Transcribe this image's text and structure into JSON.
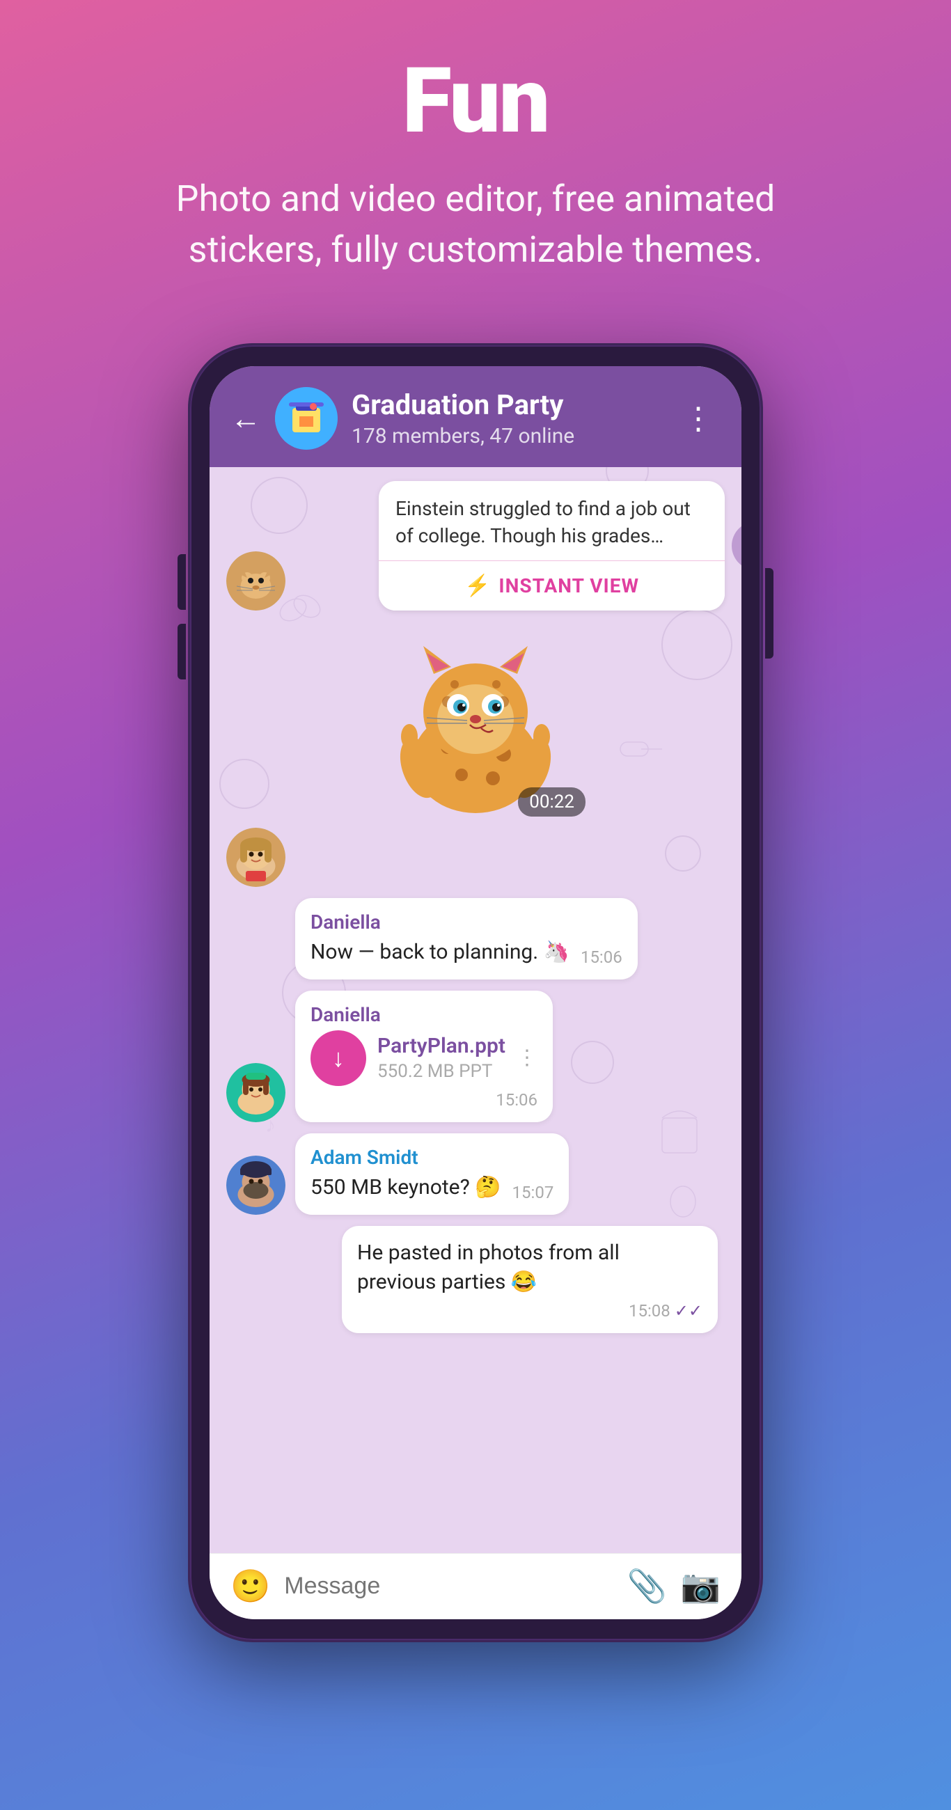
{
  "page": {
    "title": "Fun",
    "subtitle": "Photo and video editor, free animated stickers, fully customizable themes.",
    "header": {
      "group_name": "Graduation Party",
      "group_meta": "178 members, 47 online",
      "back_label": "←",
      "more_label": "⋮"
    },
    "messages": [
      {
        "type": "article",
        "text": "Einstein struggled to find a job out of college. Though his grades…",
        "instant_view_label": "INSTANT VIEW"
      },
      {
        "type": "sticker",
        "timer": "00:22"
      },
      {
        "type": "incoming",
        "sender": "Daniella",
        "text": "Now — back to planning. 🦄",
        "time": "15:06"
      },
      {
        "type": "file",
        "sender": "Daniella",
        "file_name": "PartyPlan.ppt",
        "file_size": "550.2 MB PPT",
        "time": "15:06"
      },
      {
        "type": "incoming2",
        "sender": "Adam Smidt",
        "text": "550 MB keynote? 🤔",
        "time": "15:07"
      },
      {
        "type": "outgoing",
        "text": "He pasted in photos from all previous parties 😂",
        "time": "15:08",
        "checks": "✓✓"
      }
    ],
    "input": {
      "placeholder": "Message"
    }
  }
}
